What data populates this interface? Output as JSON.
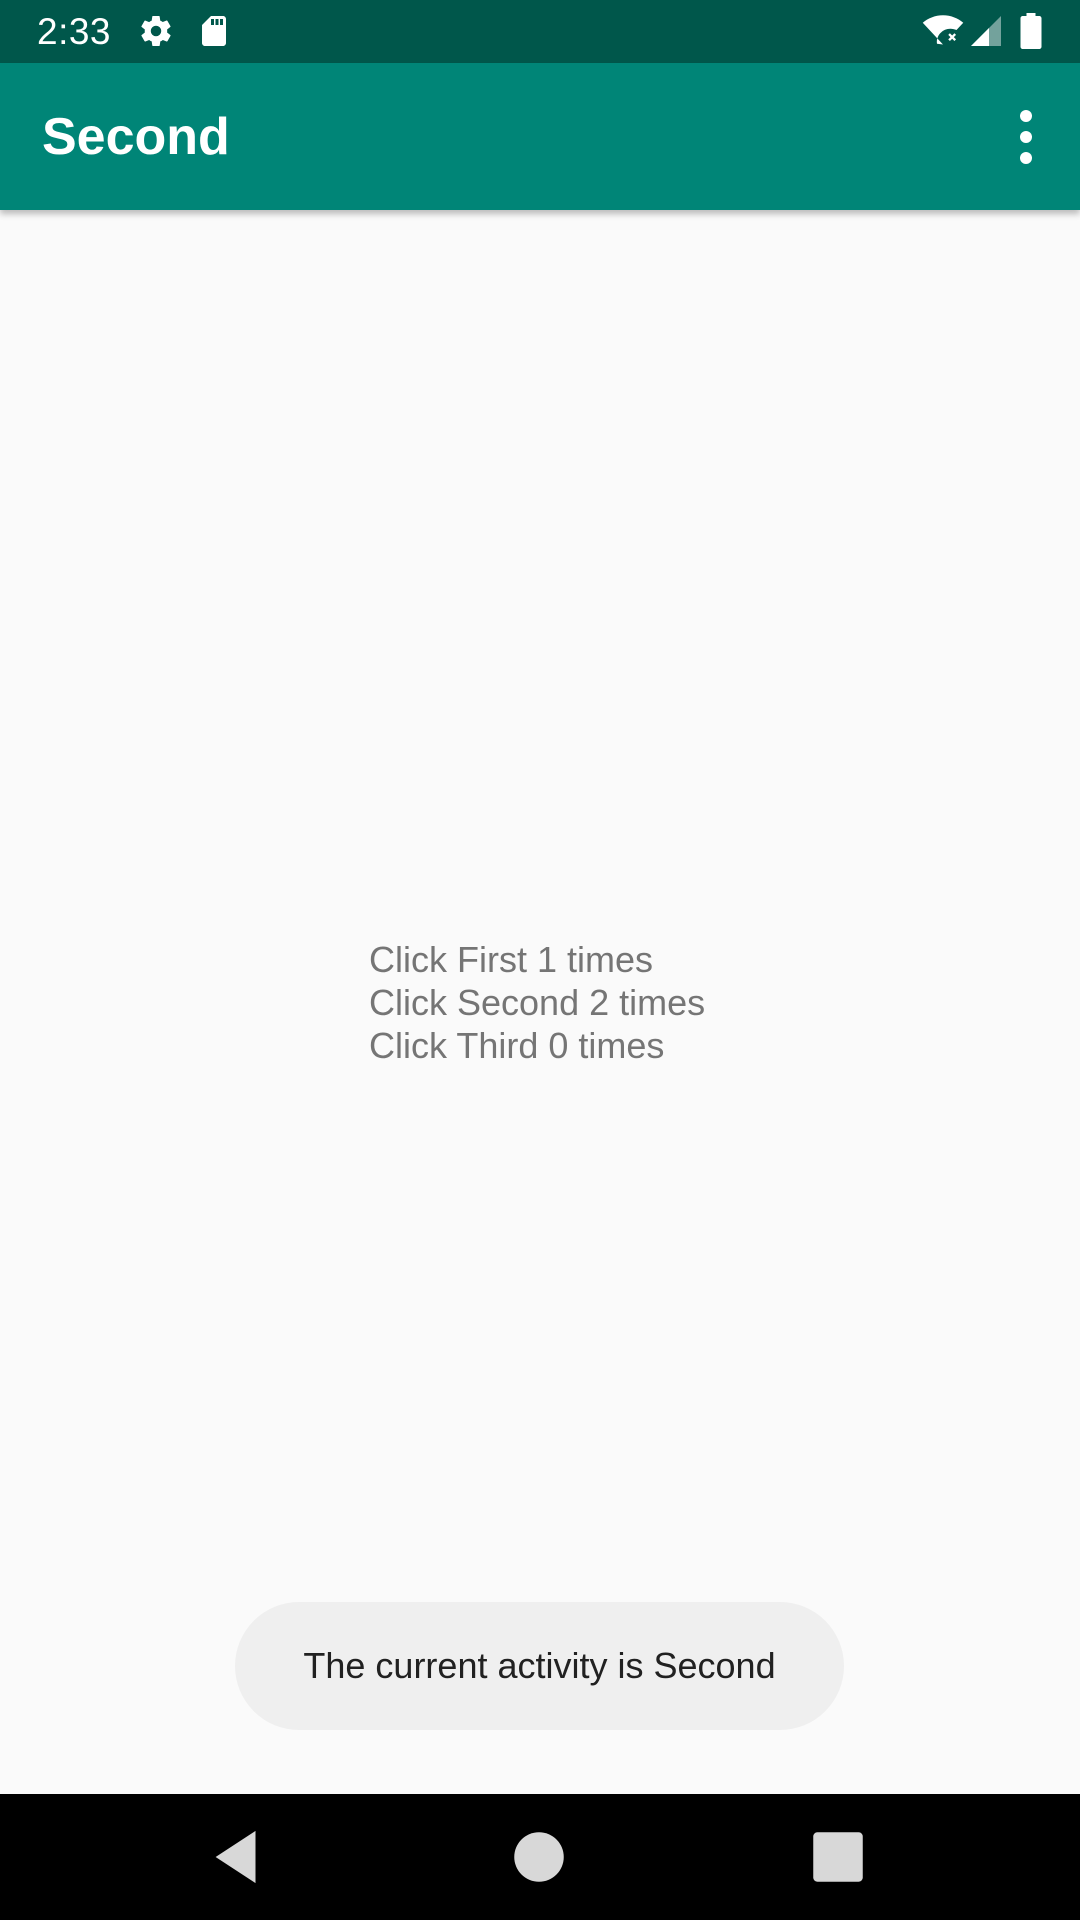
{
  "status_bar": {
    "time": "2:33",
    "icons": [
      "gear-icon",
      "sd-card-icon",
      "wifi-icon",
      "cell-signal-icon",
      "battery-icon"
    ]
  },
  "app_bar": {
    "title": "Second",
    "menu_icon": "more-vert-icon",
    "background_color": "#008577"
  },
  "content": {
    "lines": [
      "Click First 1 times",
      "Click Second 2 times",
      "Click Third 0 times"
    ]
  },
  "toast": {
    "message": "The current activity is Second"
  },
  "nav_bar": {
    "buttons": [
      "back-icon",
      "home-icon",
      "recents-icon"
    ]
  },
  "colors": {
    "status_bar": "#00574b",
    "app_bar": "#008577",
    "background": "#fafafa",
    "text_secondary": "#757575",
    "toast_bg": "#efefef"
  }
}
